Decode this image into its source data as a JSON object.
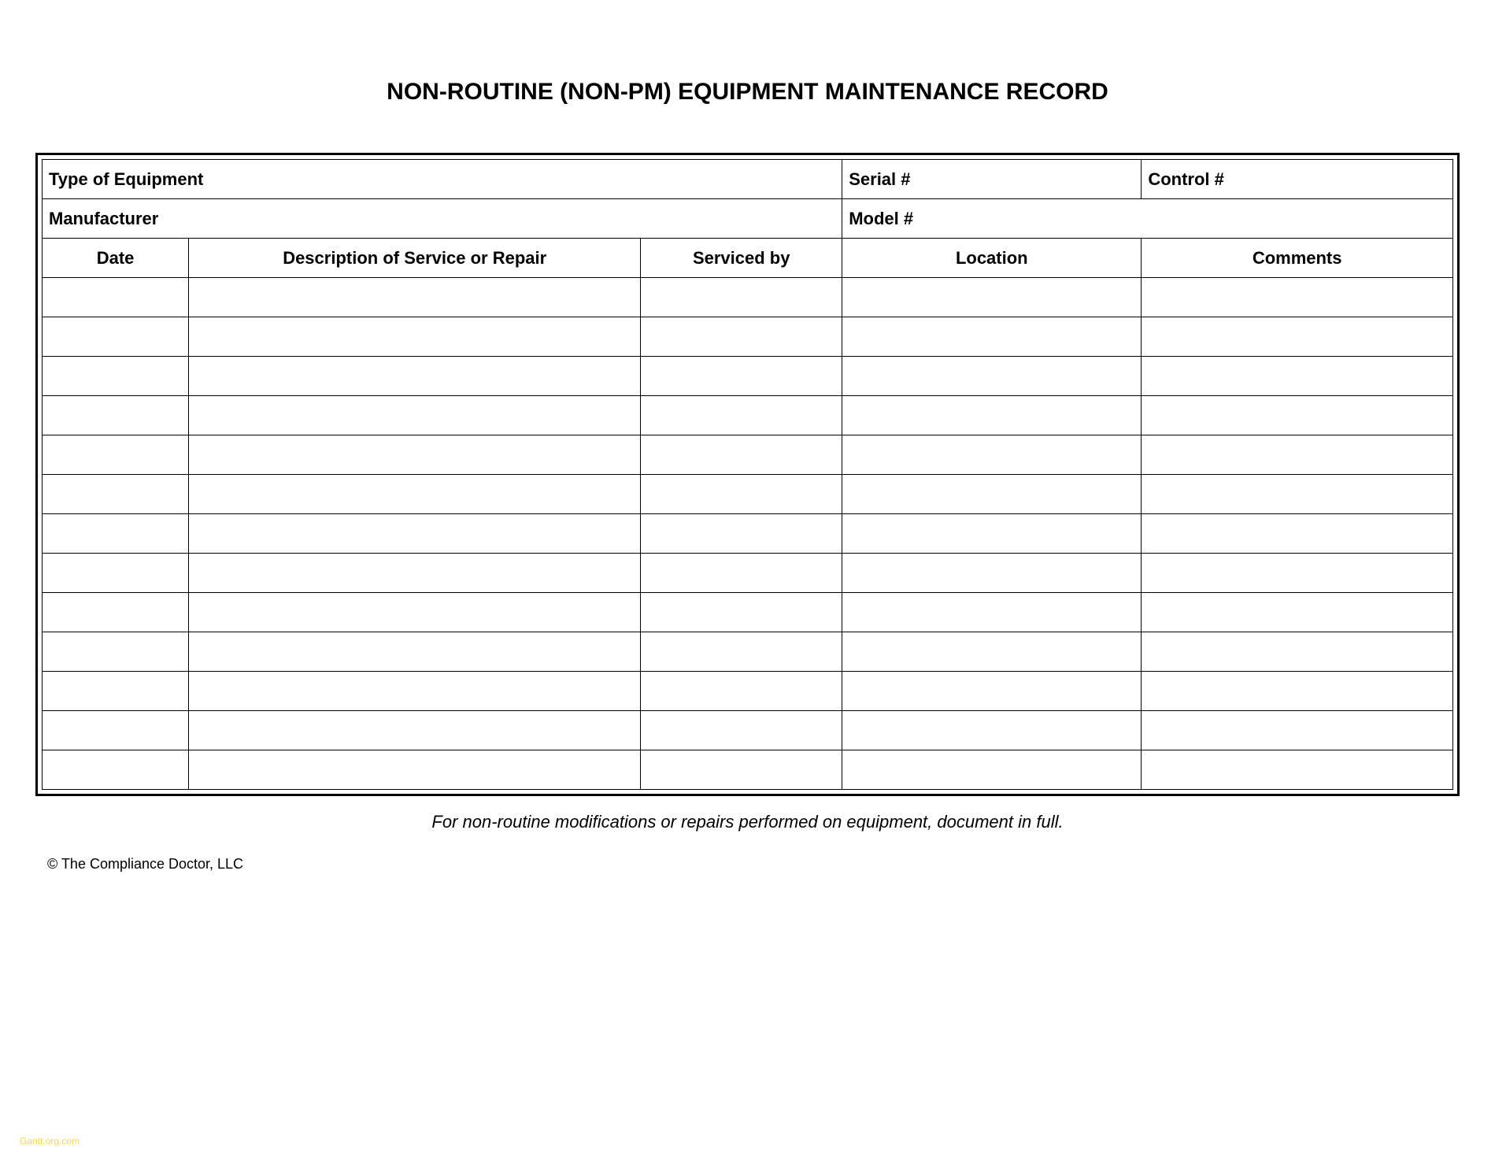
{
  "title": "NON-ROUTINE (NON-PM) EQUIPMENT MAINTENANCE RECORD",
  "info": {
    "type_of_equipment_label": "Type of Equipment",
    "serial_label": "Serial #",
    "control_label": "Control #",
    "manufacturer_label": "Manufacturer",
    "model_label": "Model #"
  },
  "columns": {
    "date": "Date",
    "description": "Description of Service or Repair",
    "serviced_by": "Serviced by",
    "location": "Location",
    "comments": "Comments"
  },
  "rows": [
    {
      "date": "",
      "description": "",
      "serviced_by": "",
      "location": "",
      "comments": ""
    },
    {
      "date": "",
      "description": "",
      "serviced_by": "",
      "location": "",
      "comments": ""
    },
    {
      "date": "",
      "description": "",
      "serviced_by": "",
      "location": "",
      "comments": ""
    },
    {
      "date": "",
      "description": "",
      "serviced_by": "",
      "location": "",
      "comments": ""
    },
    {
      "date": "",
      "description": "",
      "serviced_by": "",
      "location": "",
      "comments": ""
    },
    {
      "date": "",
      "description": "",
      "serviced_by": "",
      "location": "",
      "comments": ""
    },
    {
      "date": "",
      "description": "",
      "serviced_by": "",
      "location": "",
      "comments": ""
    },
    {
      "date": "",
      "description": "",
      "serviced_by": "",
      "location": "",
      "comments": ""
    },
    {
      "date": "",
      "description": "",
      "serviced_by": "",
      "location": "",
      "comments": ""
    },
    {
      "date": "",
      "description": "",
      "serviced_by": "",
      "location": "",
      "comments": ""
    },
    {
      "date": "",
      "description": "",
      "serviced_by": "",
      "location": "",
      "comments": ""
    },
    {
      "date": "",
      "description": "",
      "serviced_by": "",
      "location": "",
      "comments": ""
    },
    {
      "date": "",
      "description": "",
      "serviced_by": "",
      "location": "",
      "comments": ""
    }
  ],
  "footnote": "For non-routine modifications or repairs performed on equipment, document in full.",
  "copyright": "© The Compliance Doctor, LLC",
  "watermark": "Gantt.org.com"
}
